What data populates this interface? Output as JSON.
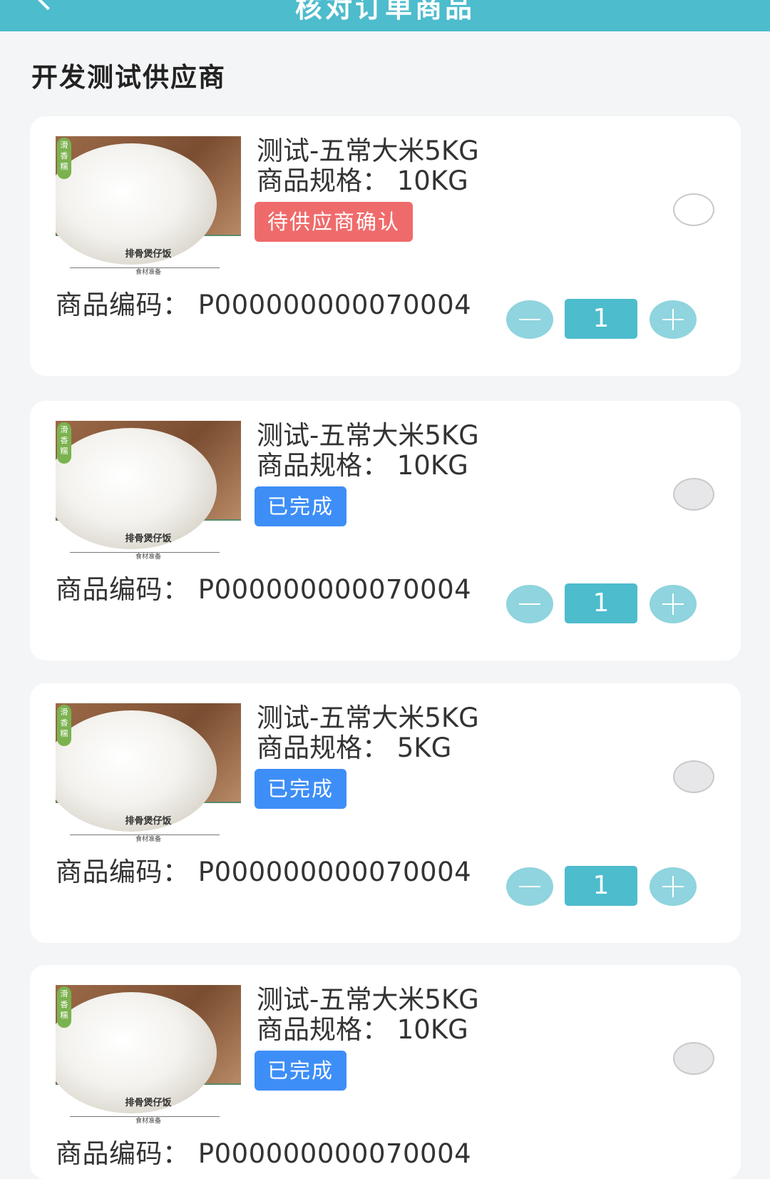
{
  "header": {
    "title": "核对订单商品",
    "back_icon": "chevron-left-icon"
  },
  "supplier": {
    "name": "开发测试供应商"
  },
  "colors": {
    "primary": "#4dbccd",
    "pending": "#ef6b6b",
    "done": "#3e8ef7",
    "stepper_button": "#8fd4de"
  },
  "thumbnail": {
    "caption": "排骨煲仔饭",
    "sub_caption": "食材准备",
    "leaf_text": "滑香糯"
  },
  "items": [
    {
      "name": "测试-五常大米5KG",
      "spec": "商品规格： 10KG",
      "status": "待供应商确认",
      "code": "商品编码： P000000000070004",
      "quantity": "1"
    },
    {
      "name": "测试-五常大米5KG",
      "spec": "商品规格： 10KG",
      "status": "已完成",
      "code": "商品编码： P000000000070004",
      "quantity": "1"
    },
    {
      "name": "测试-五常大米5KG",
      "spec": "商品规格： 5KG",
      "status": "已完成",
      "code": "商品编码： P000000000070004",
      "quantity": "1"
    },
    {
      "name": "测试-五常大米5KG",
      "spec": "商品规格： 10KG",
      "status": "已完成",
      "code": "商品编码： P000000000070004",
      "quantity": ""
    }
  ]
}
